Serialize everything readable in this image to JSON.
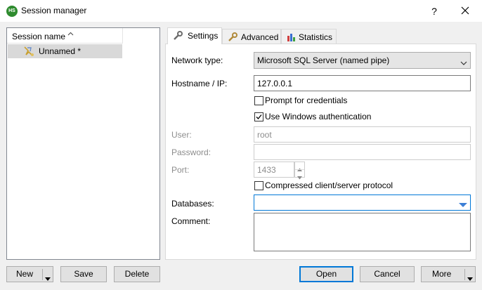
{
  "window": {
    "app_icon_text": "HS",
    "title": "Session manager",
    "help_label": "?",
    "close_label": ""
  },
  "sessions": {
    "column_header": "Session name",
    "sort_indicator": "^",
    "items": [
      {
        "label": "Unnamed *",
        "selected": true,
        "icon": "session-icon"
      }
    ]
  },
  "left_buttons": {
    "new_label": "New",
    "save_label": "Save",
    "delete_label": "Delete"
  },
  "tabs": [
    {
      "label": "Settings",
      "icon": "wrench-icon",
      "active": true
    },
    {
      "label": "Advanced",
      "icon": "wrench-icon",
      "active": false
    },
    {
      "label": "Statistics",
      "icon": "bar-chart-icon",
      "active": false
    }
  ],
  "settings": {
    "network_type_label": "Network type:",
    "network_type_value": "Microsoft SQL Server (named pipe)",
    "hostname_label": "Hostname / IP:",
    "hostname_value": "127.0.0.1",
    "prompt_credentials_label": "Prompt for credentials",
    "prompt_credentials_checked": false,
    "windows_auth_label": "Use Windows authentication",
    "windows_auth_checked": true,
    "user_label": "User:",
    "user_value": "root",
    "password_label": "Password:",
    "password_value": "",
    "port_label": "Port:",
    "port_value": "1433",
    "compressed_label": "Compressed client/server protocol",
    "compressed_checked": false,
    "databases_label": "Databases:",
    "databases_value": "",
    "comment_label": "Comment:",
    "comment_value": ""
  },
  "bottom_buttons": {
    "open_label": "Open",
    "cancel_label": "Cancel",
    "more_label": "More"
  },
  "colors": {
    "accent": "#0078d7",
    "selection": "#d9d9d9",
    "dropdown_arrow": "#3c7fd6"
  }
}
